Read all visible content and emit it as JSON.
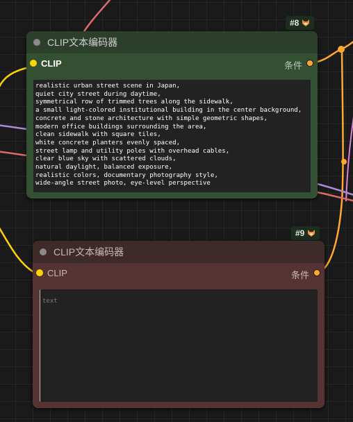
{
  "canvas": {
    "wire_colors": {
      "clip": "#ffd500",
      "conditioning": "#ffa931",
      "model": "#b39ddb",
      "vae": "#ff6e6e"
    }
  },
  "nodes": [
    {
      "id_badge": "#8",
      "title": "CLIP文本编码器",
      "input_label": "CLIP",
      "output_label": "条件",
      "text_value": "realistic urban street scene in Japan,\nquiet city street during daytime,\nsymmetrical row of trimmed trees along the sidewalk,\na small light-colored institutional building in the center background,\nconcrete and stone architecture with simple geometric shapes,\nmodern office buildings surrounding the area,\nclean sidewalk with square tiles,\nwhite concrete planters evenly spaced,\nstreet lamp and utility poles with overhead cables,\nclear blue sky with scattered clouds,\nnatural daylight, balanced exposure,\nrealistic colors, documentary photography style,\nwide-angle street photo, eye-level perspective",
      "header_color": "#2b3f2b",
      "body_color": "#335033",
      "badge_icon": "fox-icon"
    },
    {
      "id_badge": "#9",
      "title": "CLIP文本编码器",
      "input_label": "CLIP",
      "output_label": "条件",
      "text_value": "",
      "placeholder": "text",
      "header_color": "#3f2a2a",
      "body_color": "#553333",
      "badge_icon": "fox-icon"
    }
  ]
}
